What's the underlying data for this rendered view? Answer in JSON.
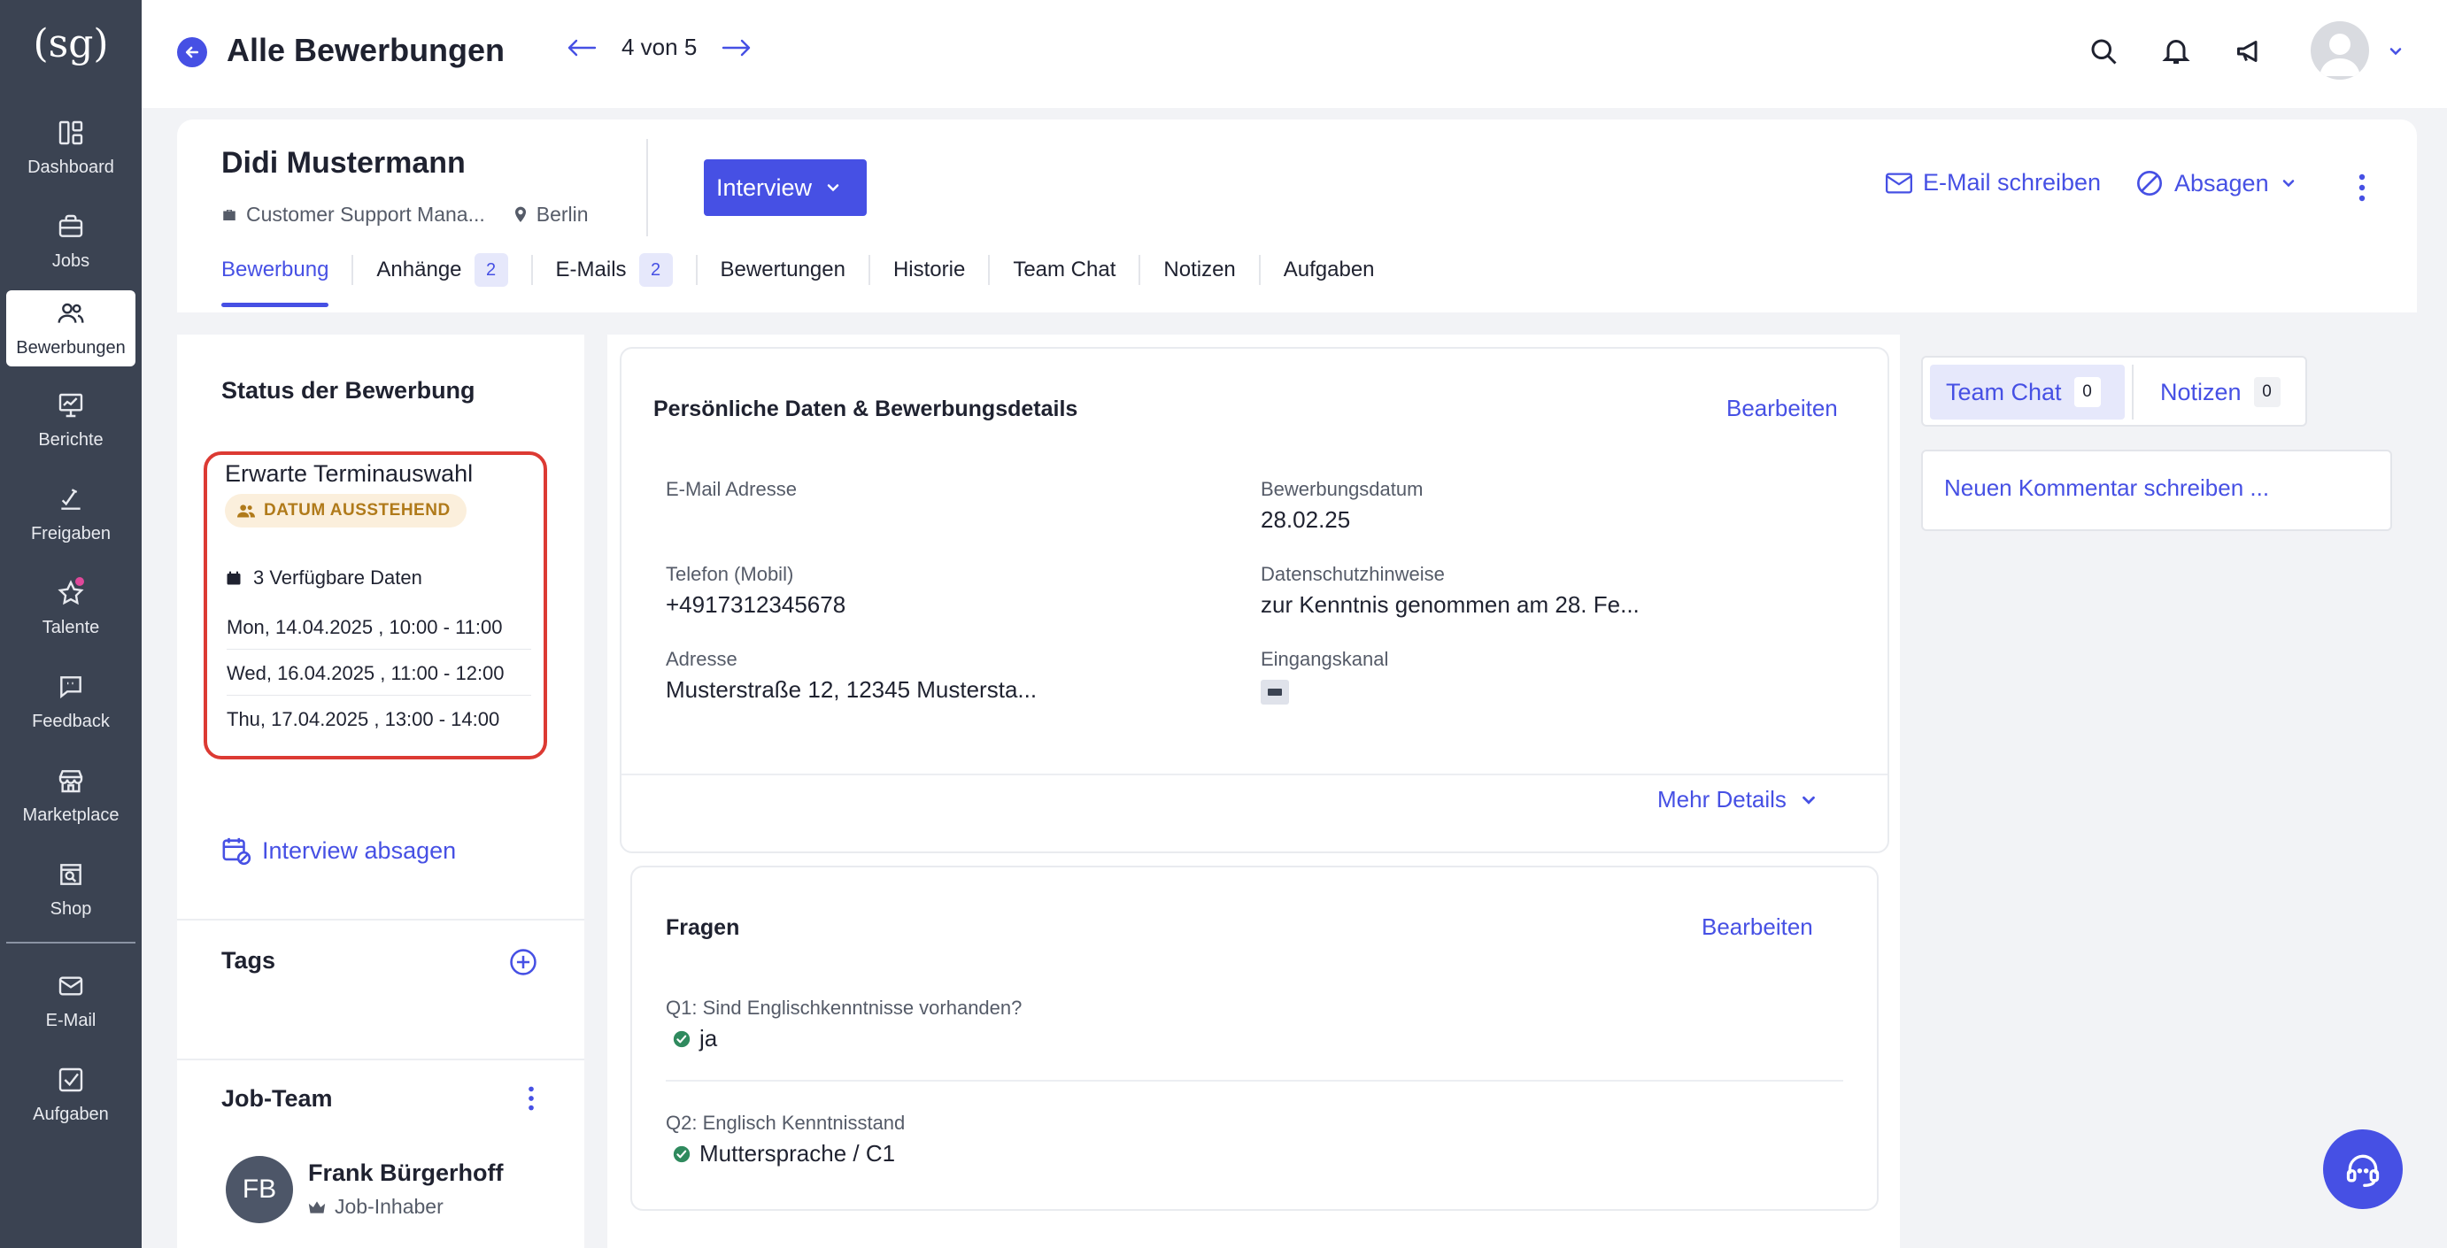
{
  "sidebar": {
    "logo": "(sg)",
    "items": [
      {
        "label": "Dashboard",
        "icon": "dashboard-icon"
      },
      {
        "label": "Jobs",
        "icon": "briefcase-icon"
      },
      {
        "label": "Bewerbungen",
        "icon": "users-icon",
        "active": true
      },
      {
        "label": "Berichte",
        "icon": "chart-icon"
      },
      {
        "label": "Freigaben",
        "icon": "approval-icon"
      },
      {
        "label": "Talente",
        "icon": "star-icon"
      },
      {
        "label": "Feedback",
        "icon": "feedback-icon"
      },
      {
        "label": "Marketplace",
        "icon": "store-icon"
      },
      {
        "label": "Shop",
        "icon": "shop-search-icon"
      },
      {
        "label": "E-Mail",
        "icon": "mail-icon"
      },
      {
        "label": "Aufgaben",
        "icon": "checkbox-icon"
      }
    ]
  },
  "topbar": {
    "title": "Alle Bewerbungen",
    "pager": "4 von 5"
  },
  "candidate": {
    "name": "Didi Mustermann",
    "job": "Customer Support Mana...",
    "location": "Berlin",
    "stage": "Interview",
    "email_action": "E-Mail schreiben",
    "reject_action": "Absagen"
  },
  "tabs": [
    {
      "label": "Bewerbung",
      "active": true
    },
    {
      "label": "Anhänge",
      "badge": "2"
    },
    {
      "label": "E-Mails",
      "badge": "2"
    },
    {
      "label": "Bewertungen"
    },
    {
      "label": "Historie"
    },
    {
      "label": "Team Chat"
    },
    {
      "label": "Notizen"
    },
    {
      "label": "Aufgaben"
    }
  ],
  "status": {
    "title": "Status der Bewerbung",
    "main": "Erwarte Terminauswahl",
    "badge": "DATUM AUSSTEHEND",
    "available": "3 Verfügbare Daten",
    "dates": [
      "Mon, 14.04.2025 , 10:00 - 11:00",
      "Wed, 16.04.2025 , 11:00 - 12:00",
      "Thu, 17.04.2025 , 13:00 - 14:00"
    ],
    "cancel": "Interview absagen"
  },
  "tags": {
    "title": "Tags"
  },
  "job_team": {
    "title": "Job-Team",
    "member_initials": "FB",
    "member_name": "Frank Bürgerhoff",
    "member_role": "Job-Inhaber"
  },
  "personal": {
    "title": "Persönliche Daten & Bewerbungsdetails",
    "edit": "Bearbeiten",
    "fields": [
      {
        "label": "E-Mail Adresse",
        "value": ""
      },
      {
        "label": "Bewerbungsdatum",
        "value": "28.02.25"
      },
      {
        "label": "Telefon (Mobil)",
        "value": "+4917312345678"
      },
      {
        "label": "Datenschutzhinweise",
        "value": "zur Kenntnis genommen am 28. Fe..."
      },
      {
        "label": "Adresse",
        "value": "Musterstraße 12, 12345 Mustersta..."
      },
      {
        "label": "Eingangskanal",
        "value": ""
      }
    ],
    "more": "Mehr Details"
  },
  "questions": {
    "title": "Fragen",
    "edit": "Bearbeiten",
    "items": [
      {
        "q": "Q1: Sind Englischkenntnisse vorhanden?",
        "a": "ja"
      },
      {
        "q": "Q2: Englisch Kenntnisstand",
        "a": "Muttersprache / C1"
      }
    ]
  },
  "right_panel": {
    "tab_chat": "Team Chat",
    "tab_chat_count": "0",
    "tab_notes": "Notizen",
    "tab_notes_count": "0",
    "comment_placeholder": "Neuen Kommentar schreiben ..."
  },
  "colors": {
    "accent": "#4650e4",
    "sidebar": "#3b4352",
    "highlight": "#dc3a33",
    "pending_bg": "#fbefdc",
    "pending_fg": "#b07a1a",
    "success": "#2f8a5e"
  }
}
